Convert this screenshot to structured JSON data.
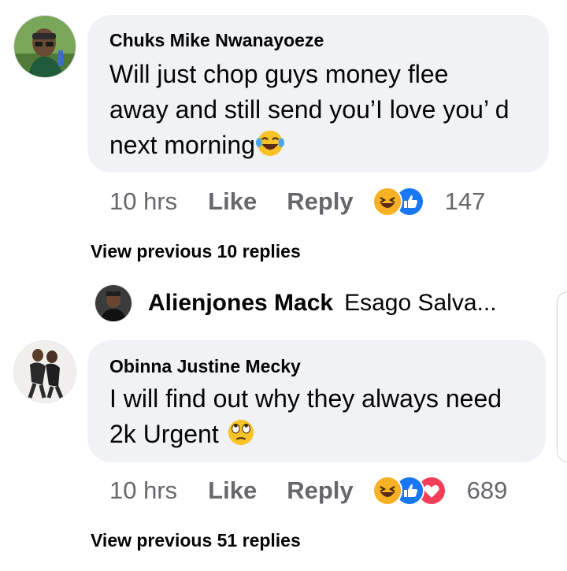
{
  "comments": [
    {
      "author": "Chuks Mike Nwanayoeze",
      "text_lines": [
        "Will just chop guys money flee",
        "away and still send you’I love you’ d",
        "next morning"
      ],
      "emoji": "laughing-tears-emoji",
      "time": "10 hrs",
      "like_label": "Like",
      "reply_label": "Reply",
      "reactions": [
        "haha",
        "like"
      ],
      "reaction_count": "147",
      "view_previous": "View previous 10 replies"
    },
    {
      "author": "Obinna Justine Mecky",
      "text_lines": [
        "I will find out why they always need",
        "2k Urgent"
      ],
      "emoji": "eye-roll-emoji",
      "time": "10 hrs",
      "like_label": "Like",
      "reply_label": "Reply",
      "reactions": [
        "haha",
        "like",
        "love"
      ],
      "reaction_count": "689",
      "view_previous": "View previous 51 replies"
    }
  ],
  "reply_preview": {
    "name": "Alienjones Mack",
    "snippet": "Esago Salva..."
  },
  "colors": {
    "bubble": "#f0f2f5",
    "meta_text": "#65676b",
    "like_blue": "#1877f2",
    "love_red": "#f33e58",
    "haha_yellow": "#f7b125"
  }
}
